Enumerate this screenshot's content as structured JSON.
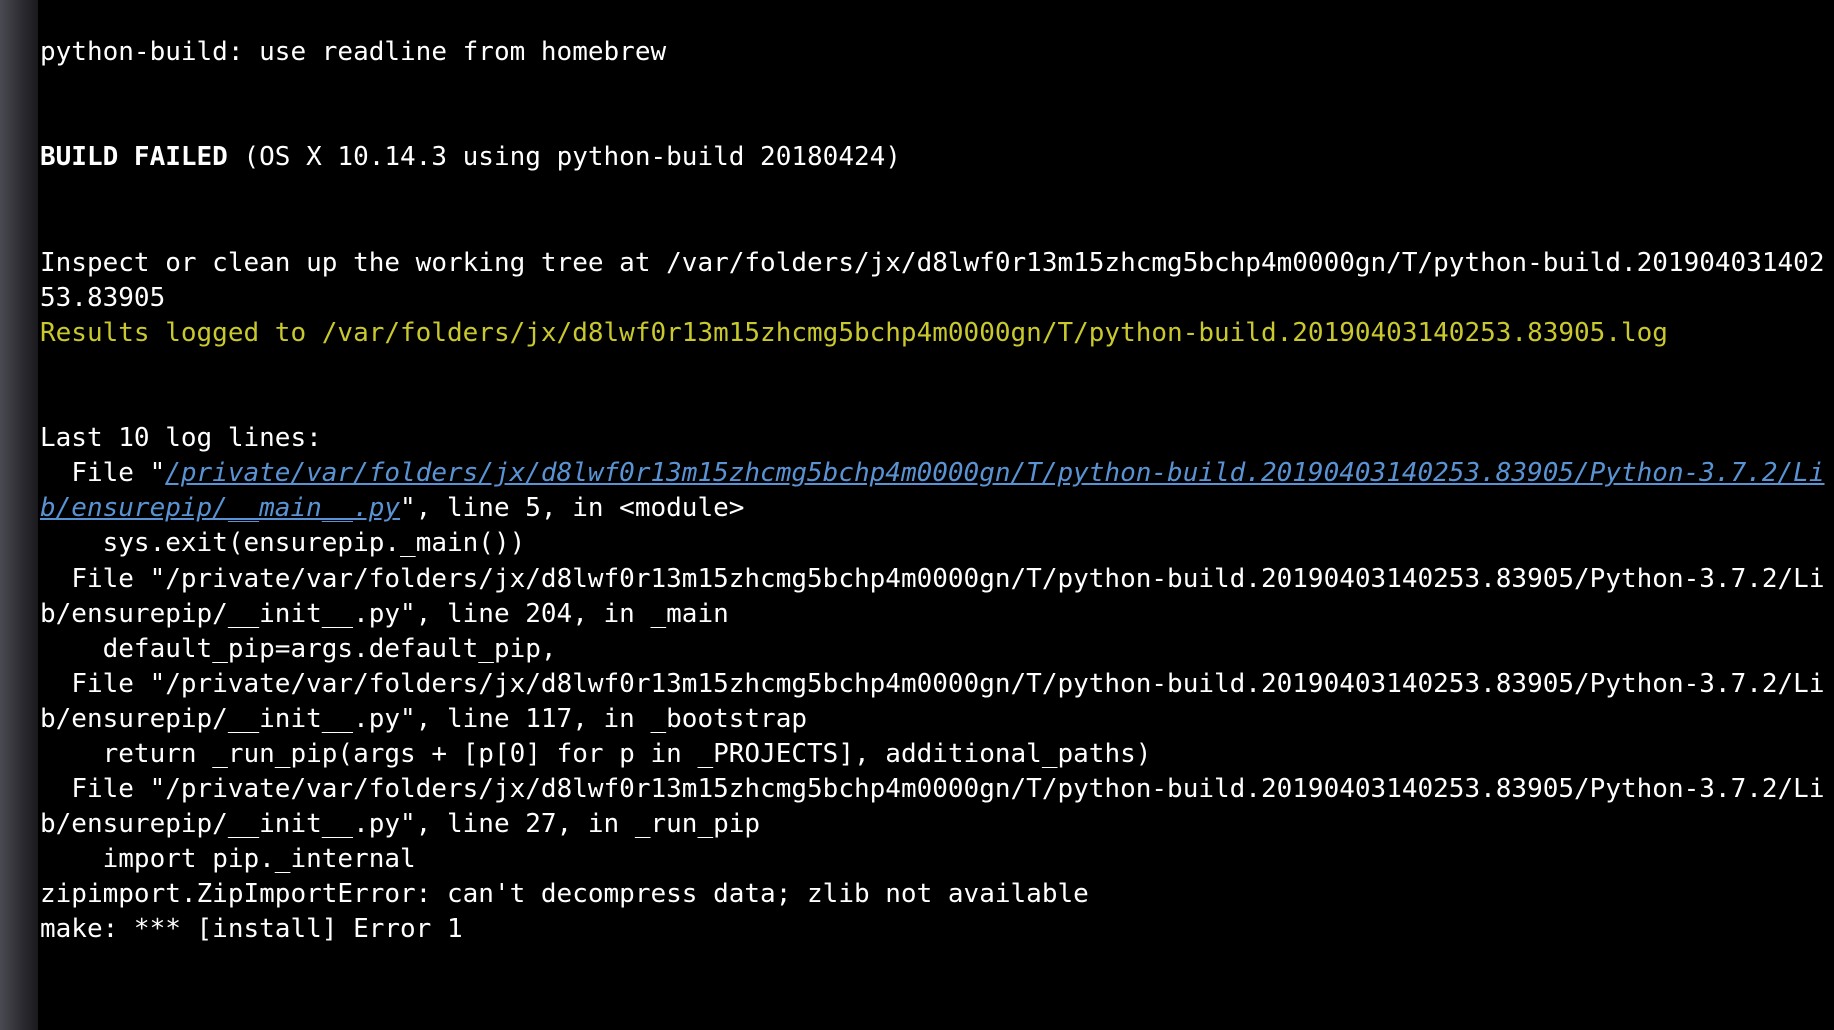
{
  "terminal": {
    "lines": {
      "l0": "python-build: use readline from homebrew",
      "l1_bold": "BUILD FAILED",
      "l1_rest": " (OS X 10.14.3 using python-build 20180424)",
      "l2": "Inspect or clean up the working tree at /var/folders/jx/d8lwf0r13m15zhcmg5bchp4m0000gn/T/python-build.20190403140253.83905",
      "l3_yellow": "Results logged to /var/folders/jx/d8lwf0r13m15zhcmg5bchp4m0000gn/T/python-build.20190403140253.83905.log",
      "l4": "Last 10 log lines:",
      "l5_prefix": "  File \"",
      "l5_link": "/private/var/folders/jx/d8lwf0r13m15zhcmg5bchp4m0000gn/T/python-build.20190403140253.83905/Python-3.7.2/Lib/ensurepip/__main__.py",
      "l5_suffix": "\", line 5, in <module>",
      "l6": "    sys.exit(ensurepip._main())",
      "l7": "  File \"/private/var/folders/jx/d8lwf0r13m15zhcmg5bchp4m0000gn/T/python-build.20190403140253.83905/Python-3.7.2/Lib/ensurepip/__init__.py\", line 204, in _main",
      "l8": "    default_pip=args.default_pip,",
      "l9": "  File \"/private/var/folders/jx/d8lwf0r13m15zhcmg5bchp4m0000gn/T/python-build.20190403140253.83905/Python-3.7.2/Lib/ensurepip/__init__.py\", line 117, in _bootstrap",
      "l10": "    return _run_pip(args + [p[0] for p in _PROJECTS], additional_paths)",
      "l11": "  File \"/private/var/folders/jx/d8lwf0r13m15zhcmg5bchp4m0000gn/T/python-build.20190403140253.83905/Python-3.7.2/Lib/ensurepip/__init__.py\", line 27, in _run_pip",
      "l12": "    import pip._internal",
      "l13": "zipimport.ZipImportError: can't decompress data; zlib not available",
      "l14": "make: *** [install] Error 1"
    }
  }
}
